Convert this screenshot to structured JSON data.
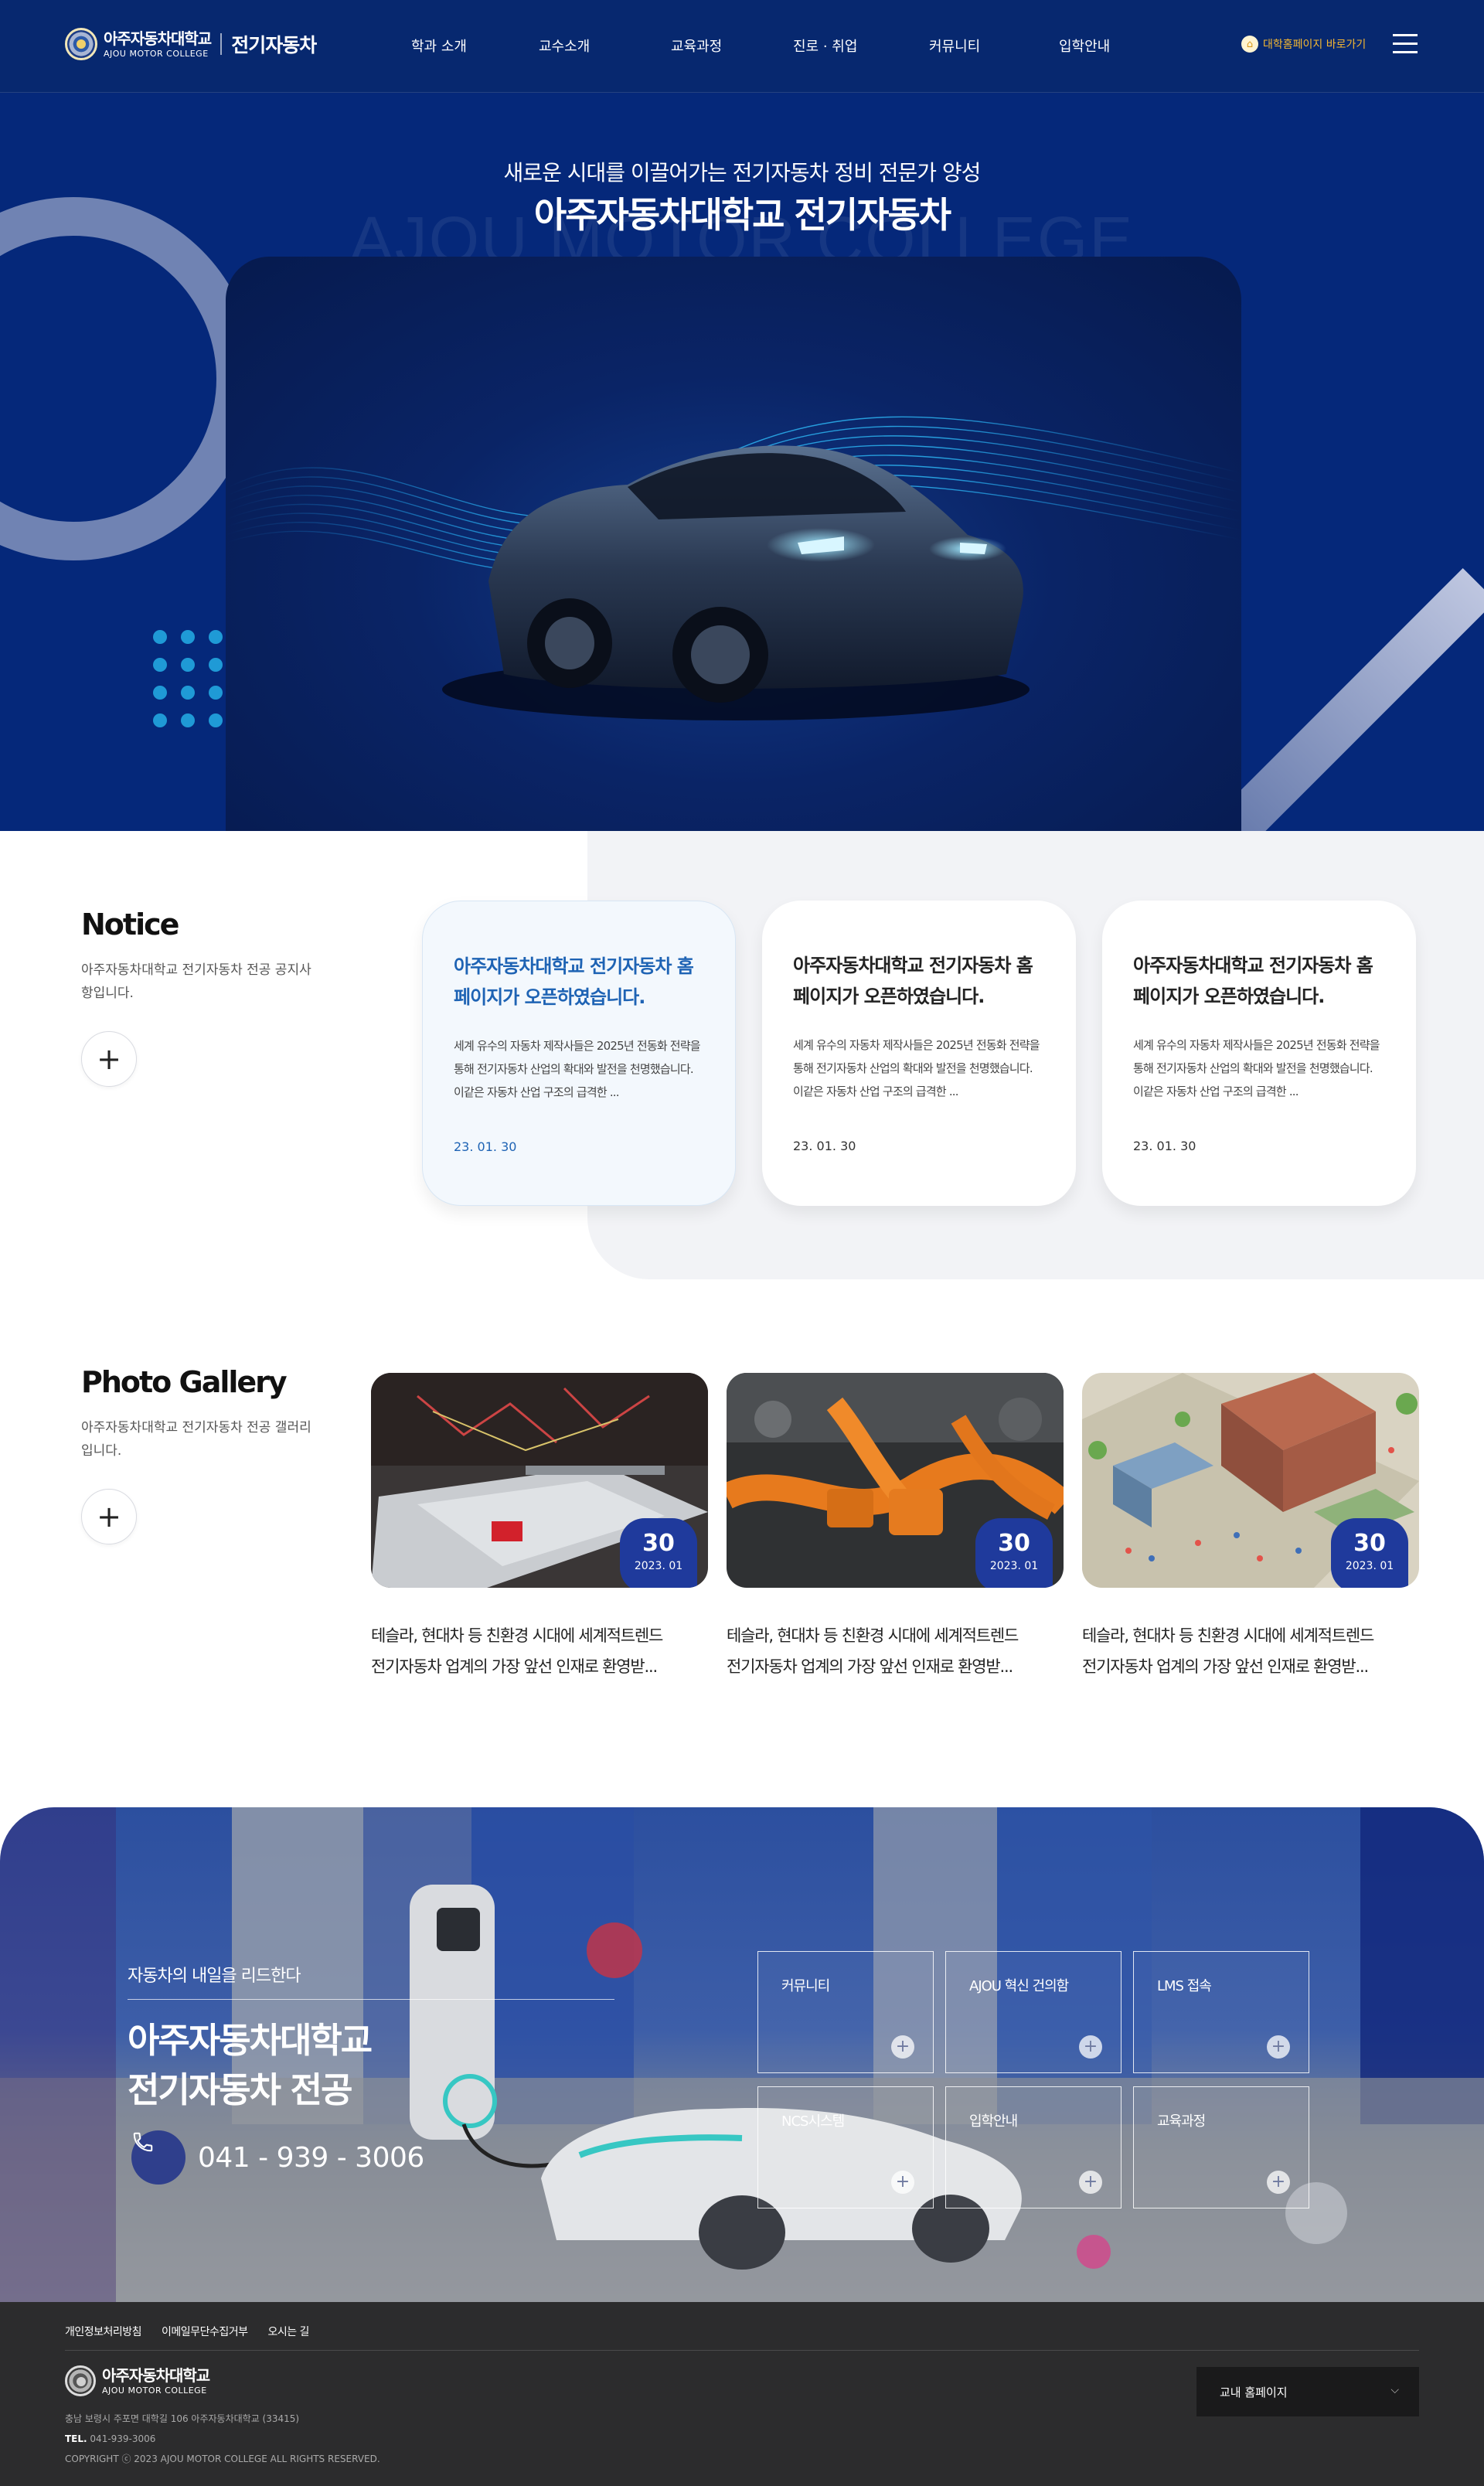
{
  "header": {
    "logo_ko": "아주자동차대학교",
    "logo_en": "AJOU MOTOR COLLEGE",
    "dept": "전기자동차",
    "nav": [
      "학과 소개",
      "교수소개",
      "교육과정",
      "진로 · 취업",
      "커뮤니티",
      "입학안내"
    ],
    "univ_link": "대학홈페이지 바로가기"
  },
  "hero": {
    "subtitle": "새로운 시대를 이끌어가는 전기자동차 정비 전문가 양성",
    "title": "아주자동차대학교 전기자동차",
    "watermark": "AJOU MOTOR COLLEGE",
    "slides_total": 3,
    "active_slide": 1
  },
  "notice": {
    "title": "Notice",
    "desc": "아주자동차대학교 전기자동차 전공 공지사항입니다.",
    "more": "+",
    "items": [
      {
        "title": "아주자동차대학교 전기자동차 홈페이지가 오픈하였습니다.",
        "text": "세계 유수의 자동차 제작사들은 2025년 전동화 전략을 통해 전기자동차 산업의 확대와 발전을 천명했습니다. 이같은 자동차 산업 구조의 급격한 ...",
        "date": "23. 01. 30"
      },
      {
        "title": "아주자동차대학교 전기자동차 홈페이지가 오픈하였습니다.",
        "text": "세계 유수의 자동차 제작사들은 2025년 전동화 전략을 통해 전기자동차 산업의 확대와 발전을 천명했습니다. 이같은 자동차 산업 구조의 급격한 ...",
        "date": "23. 01. 30"
      },
      {
        "title": "아주자동차대학교 전기자동차 홈페이지가 오픈하였습니다.",
        "text": "세계 유수의 자동차 제작사들은 2025년 전동화 전략을 통해 전기자동차 산업의 확대와 발전을 천명했습니다. 이같은 자동차 산업 구조의 급격한 ...",
        "date": "23. 01. 30"
      }
    ]
  },
  "gallery": {
    "title": "Photo Gallery",
    "desc": "아주자동차대학교 전기자동차 전공 갤러리 입니다.",
    "more": "+",
    "items": [
      {
        "day": "30",
        "month": "2023. 01",
        "line1": "테슬라, 현대차 등 친환경 시대에 세계적트렌드",
        "line2": "전기자동차 업계의 가장 앞선 인재로 환영받..."
      },
      {
        "day": "30",
        "month": "2023. 01",
        "line1": "테슬라, 현대차 등 친환경 시대에 세계적트렌드",
        "line2": "전기자동차 업계의 가장 앞선 인재로 환영받..."
      },
      {
        "day": "30",
        "month": "2023. 01",
        "line1": "테슬라, 현대차 등 친환경 시대에 세계적트렌드",
        "line2": "전기자동차 업계의 가장 앞선 인재로 환영받..."
      }
    ]
  },
  "quick": {
    "small": "자동차의 내일을 리드한다",
    "title1": "아주자동차대학교",
    "title2": "전기자동차 전공",
    "phone": "041 - 939 - 3006",
    "boxes": [
      "커뮤니티",
      "AJOU 혁신 건의함",
      "LMS 접속",
      "NCS시스템",
      "입학안내",
      "교육과정"
    ]
  },
  "footer": {
    "links": [
      "개인정보처리방침",
      "이메일무단수집거부",
      "오시는 길"
    ],
    "logo_ko": "아주자동차대학교",
    "logo_en": "AJOU MOTOR COLLEGE",
    "address": "충남 보령시 주포면 대학길 106 아주자동차대학교 (33415)",
    "tel_label": "TEL.",
    "tel": "041-939-3006",
    "copyright": "COPYRIGHT ⓒ 2023 AJOU MOTOR COLLEGE ALL RIGHTS RESERVED.",
    "select": "교내 홈페이지"
  },
  "colors": {
    "navy": "#07286f",
    "hero_bg": "#05287a",
    "accent_blue": "#1e63b4",
    "badge": "#1f3a9c",
    "univ_link": "#f5b731",
    "slider_active": "#38c7e0"
  }
}
